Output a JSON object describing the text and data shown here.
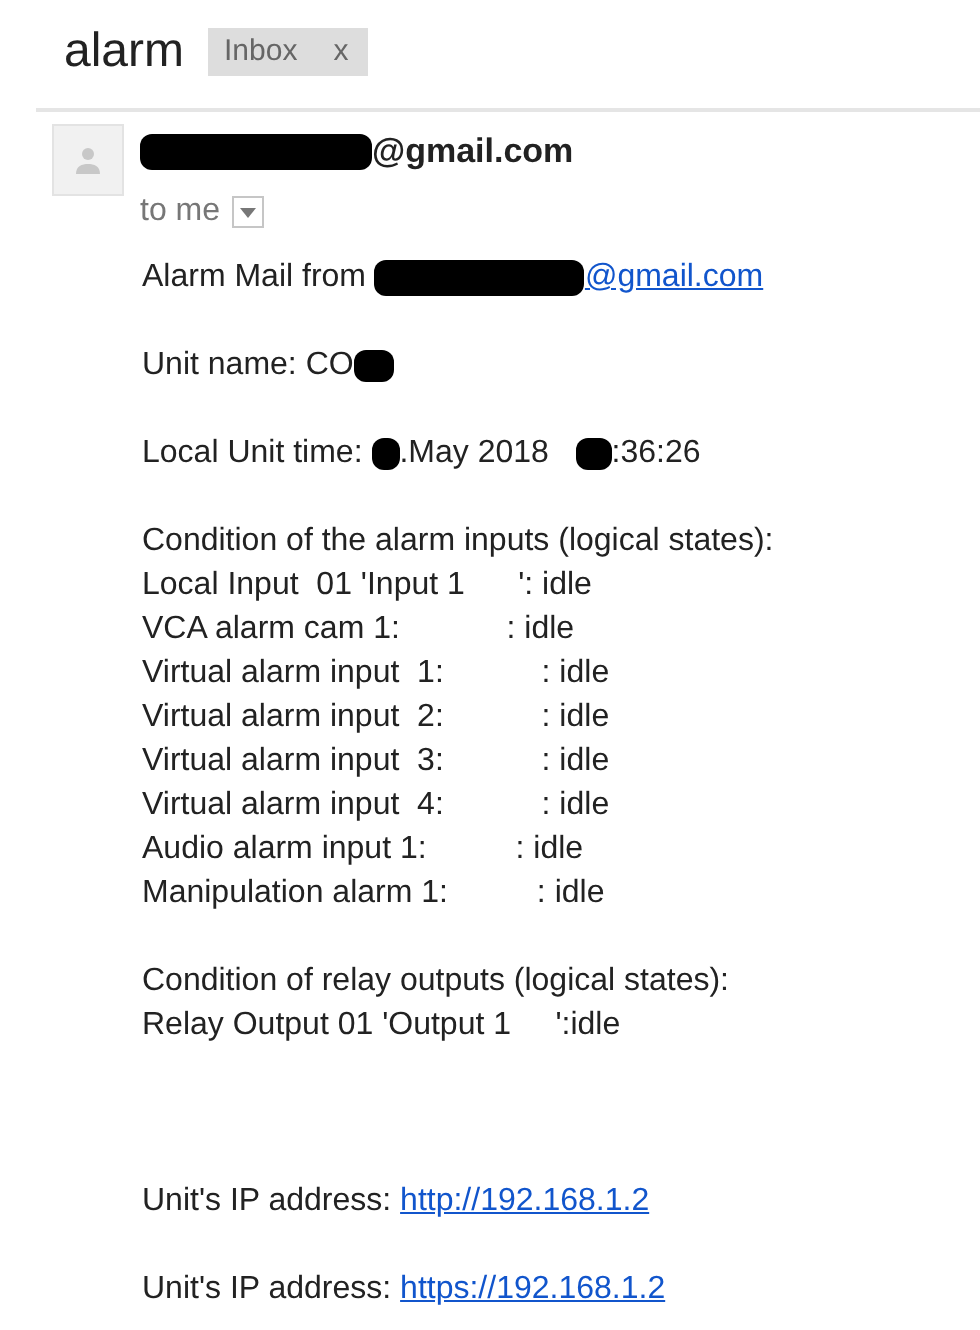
{
  "subject": "alarm",
  "labels": [
    {
      "text": "Inbox",
      "close": "x"
    }
  ],
  "sender": {
    "redacted": true,
    "text": "@gmail.com"
  },
  "recipient": "to me",
  "body": [
    [
      [
        {
          "kind": "text",
          "text": "Alarm Mail from "
        },
        {
          "kind": "link",
          "redacted": true,
          "text": "@gmail.com"
        }
      ]
    ],
    [
      [
        {
          "kind": "text",
          "text": "Unit name: CO"
        },
        {
          "kind": "redaction"
        }
      ]
    ],
    [
      [
        {
          "kind": "text",
          "text": "Local Unit time: "
        },
        {
          "kind": "redaction"
        },
        {
          "kind": "text",
          "text": ".May 2018   "
        },
        {
          "kind": "redaction"
        },
        {
          "kind": "text",
          "text": ":36:26"
        }
      ]
    ],
    [
      [
        {
          "kind": "text",
          "text": "Condition of the alarm inputs (logical states):"
        }
      ],
      [
        {
          "kind": "text",
          "text": "Local Input  01 'Input 1      ': idle"
        }
      ],
      [
        {
          "kind": "text",
          "text": "VCA alarm cam 1:            : idle"
        }
      ],
      [
        {
          "kind": "text",
          "text": "Virtual alarm input  1:           : idle"
        }
      ],
      [
        {
          "kind": "text",
          "text": "Virtual alarm input  2:           : idle"
        }
      ],
      [
        {
          "kind": "text",
          "text": "Virtual alarm input  3:           : idle"
        }
      ],
      [
        {
          "kind": "text",
          "text": "Virtual alarm input  4:           : idle"
        }
      ],
      [
        {
          "kind": "text",
          "text": "Audio alarm input 1:          : idle"
        }
      ],
      [
        {
          "kind": "text",
          "text": "Manipulation alarm 1:          : idle"
        }
      ]
    ],
    [
      [
        {
          "kind": "text",
          "text": "Condition of relay outputs (logical states):"
        }
      ],
      [
        {
          "kind": "text",
          "text": "Relay Output 01 'Output 1     ':idle"
        }
      ]
    ],
    [
      [
        {
          "kind": "text",
          "text": "Unit's IP address: "
        },
        {
          "kind": "link",
          "redacted": false,
          "text": "http://192.168.1.2"
        }
      ]
    ],
    [
      [
        {
          "kind": "text",
          "text": "Unit's IP address: "
        },
        {
          "kind": "link",
          "redacted": false,
          "text": "https://192.168.1.2"
        }
      ]
    ]
  ]
}
